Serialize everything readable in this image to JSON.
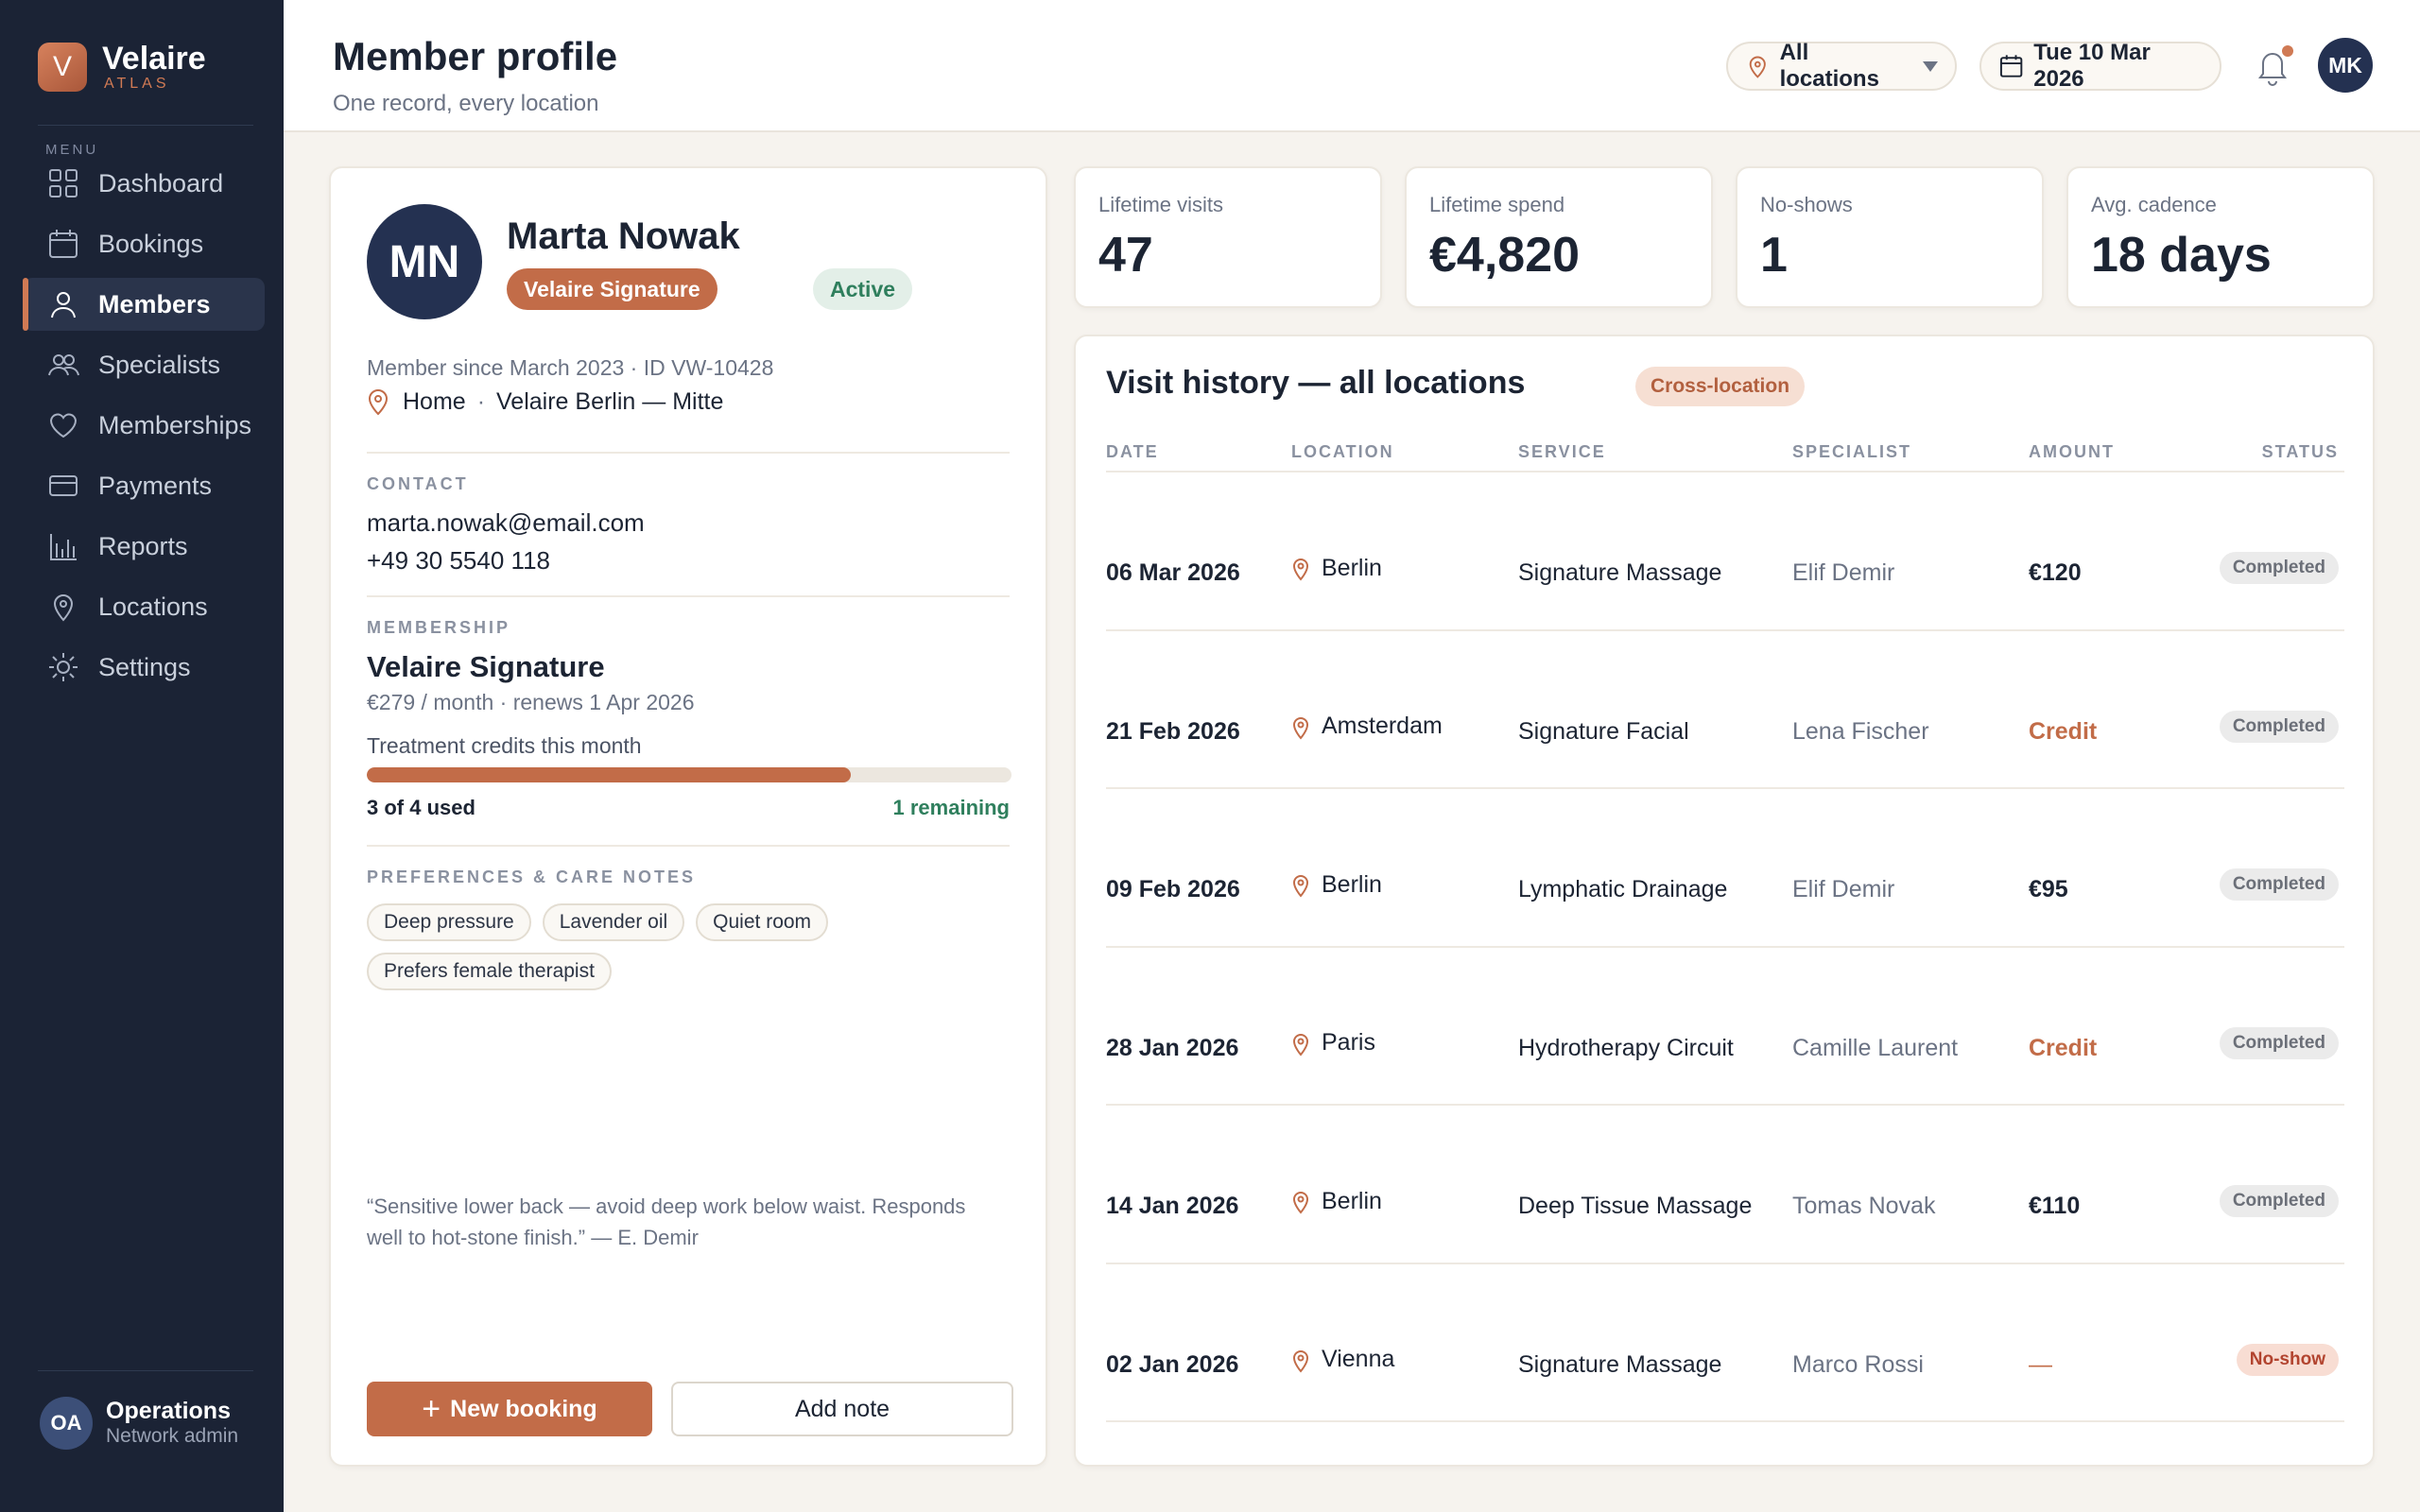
{
  "brand": {
    "initial": "V",
    "name": "Velaire",
    "sub": "ATLAS"
  },
  "sidebar": {
    "menu_label": "MENU",
    "items": [
      {
        "label": "Dashboard",
        "icon": "grid-icon"
      },
      {
        "label": "Bookings",
        "icon": "calendar-icon"
      },
      {
        "label": "Members",
        "icon": "user-icon",
        "active": true
      },
      {
        "label": "Specialists",
        "icon": "users-icon"
      },
      {
        "label": "Memberships",
        "icon": "heart-icon"
      },
      {
        "label": "Payments",
        "icon": "card-icon"
      },
      {
        "label": "Reports",
        "icon": "bar-chart-icon"
      },
      {
        "label": "Locations",
        "icon": "pin-icon"
      },
      {
        "label": "Settings",
        "icon": "gear-icon"
      }
    ],
    "user": {
      "initials": "OA",
      "name": "Operations",
      "role": "Network admin"
    }
  },
  "header": {
    "title": "Member profile",
    "subtitle": "One record, every location",
    "location_filter": "All locations",
    "date": "Tue 10 Mar 2026",
    "user_initials": "MK"
  },
  "member": {
    "initials": "MN",
    "name": "Marta Nowak",
    "tier": "Velaire Signature",
    "status": "Active",
    "meta": "Member since March 2023 · ID VW-10428",
    "home_label": "Home",
    "home_separator": "·",
    "home_location": "Velaire Berlin — Mitte",
    "contact_label": "CONTACT",
    "email": "marta.nowak@email.com",
    "phone": "+49 30 5540 118",
    "membership_label": "MEMBERSHIP",
    "membership_name": "Velaire Signature",
    "membership_price": "€279 / month · renews 1 Apr 2026",
    "credits_label": "Treatment credits this month",
    "credits_used": 3,
    "credits_total": 4,
    "credits_used_text": "3 of 4 used",
    "credits_remaining_text": "1 remaining",
    "prefs_label": "PREFERENCES & CARE NOTES",
    "prefs": [
      "Deep pressure",
      "Lavender oil",
      "Quiet room",
      "Prefers female therapist"
    ],
    "care_note": "“Sensitive lower back — avoid deep work below waist. Responds well to hot-stone finish.” — E. Demir",
    "new_booking_label": "New booking",
    "add_note_label": "Add note"
  },
  "stats": [
    {
      "label": "Lifetime visits",
      "value": "47"
    },
    {
      "label": "Lifetime spend",
      "value": "€4,820"
    },
    {
      "label": "No-shows",
      "value": "1"
    },
    {
      "label": "Avg. cadence",
      "value": "18 days"
    }
  ],
  "history": {
    "title": "Visit history — all locations",
    "badge": "Cross-location",
    "columns": [
      "DATE",
      "LOCATION",
      "SERVICE",
      "SPECIALIST",
      "AMOUNT",
      "STATUS"
    ],
    "rows": [
      {
        "date": "06 Mar 2026",
        "location": "Berlin",
        "service": "Signature Massage",
        "specialist": "Elif Demir",
        "amount": "€120",
        "amount_type": "money",
        "status": "Completed"
      },
      {
        "date": "21 Feb 2026",
        "location": "Amsterdam",
        "service": "Signature Facial",
        "specialist": "Lena Fischer",
        "amount": "Credit",
        "amount_type": "credit",
        "status": "Completed"
      },
      {
        "date": "09 Feb 2026",
        "location": "Berlin",
        "service": "Lymphatic Drainage",
        "specialist": "Elif Demir",
        "amount": "€95",
        "amount_type": "money",
        "status": "Completed"
      },
      {
        "date": "28 Jan 2026",
        "location": "Paris",
        "service": "Hydrotherapy Circuit",
        "specialist": "Camille Laurent",
        "amount": "Credit",
        "amount_type": "credit",
        "status": "Completed"
      },
      {
        "date": "14 Jan 2026",
        "location": "Berlin",
        "service": "Deep Tissue Massage",
        "specialist": "Tomas Novak",
        "amount": "€110",
        "amount_type": "money",
        "status": "Completed"
      },
      {
        "date": "02 Jan 2026",
        "location": "Vienna",
        "service": "Signature Massage",
        "specialist": "Marco Rossi",
        "amount": "—",
        "amount_type": "none",
        "status": "No-show"
      }
    ]
  },
  "colors": {
    "accent": "#c26c48",
    "sidebar": "#1b2335",
    "success": "#2f7f5d",
    "navy": "#243151"
  }
}
